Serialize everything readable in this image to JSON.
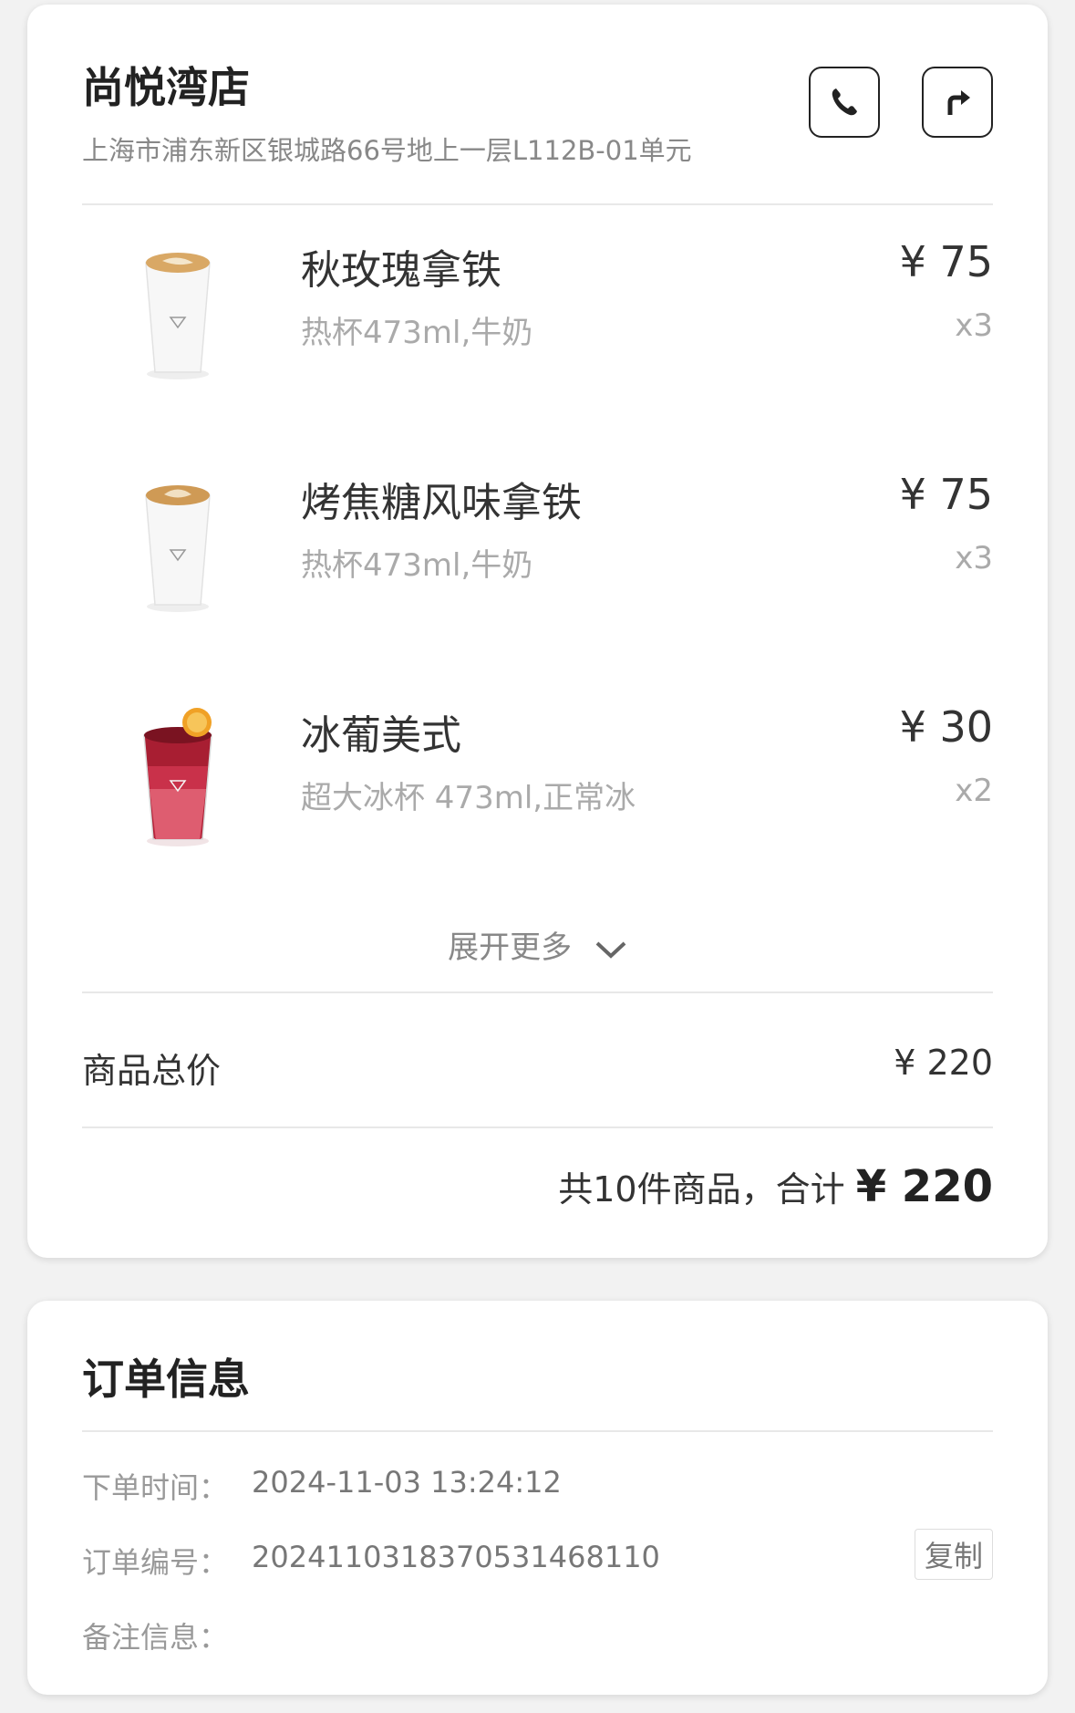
{
  "store": {
    "name": "尚悦湾店",
    "address": "上海市浦东新区银城路66号地上一层L112B-01单元",
    "phone_icon": "phone-icon",
    "nav_icon": "directions-icon"
  },
  "items": [
    {
      "name": "秋玫瑰拿铁",
      "spec": "热杯473ml,牛奶",
      "price": "¥ 75",
      "qty": "x3",
      "image": "hot-latte-cup"
    },
    {
      "name": "烤焦糖风味拿铁",
      "spec": "热杯473ml,牛奶",
      "price": "¥ 75",
      "qty": "x3",
      "image": "hot-latte-cup"
    },
    {
      "name": "冰葡美式",
      "spec": "超大冰杯 473ml,正常冰",
      "price": "¥ 30",
      "qty": "x2",
      "image": "iced-grapefruit-americano"
    }
  ],
  "expand_label": "展开更多",
  "subtotal": {
    "label": "商品总价",
    "value": "¥ 220"
  },
  "total": {
    "prefix": "共10件商品，合计",
    "amount": "¥ 220"
  },
  "order_info": {
    "title": "订单信息",
    "time_label": "下单时间：",
    "time_value": "2024-11-03 13:24:12",
    "number_label": "订单编号：",
    "number_value": "2024110318370531468110",
    "copy_label": "复制",
    "note_label": "备注信息："
  },
  "colors": {
    "background": "#f2f2f2",
    "card": "#ffffff",
    "muted_text": "#aaaaaa",
    "iced_drink": "#b3263a"
  }
}
